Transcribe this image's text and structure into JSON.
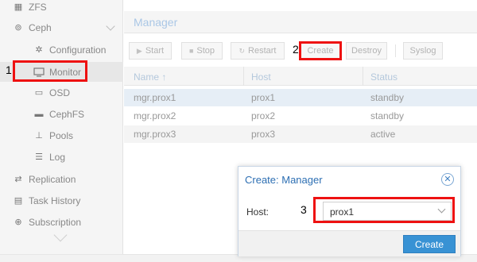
{
  "sidebar": {
    "items": [
      {
        "label": "ZFS",
        "icon": "zfs-icon"
      },
      {
        "label": "Ceph",
        "icon": "ceph-icon"
      },
      {
        "label": "Configuration",
        "icon": "gear-icon"
      },
      {
        "label": "Monitor",
        "icon": "monitor-icon"
      },
      {
        "label": "OSD",
        "icon": "hdd-icon"
      },
      {
        "label": "CephFS",
        "icon": "folder-icon"
      },
      {
        "label": "Pools",
        "icon": "sitemap-icon"
      },
      {
        "label": "Log",
        "icon": "list-icon"
      },
      {
        "label": "Replication",
        "icon": "retweet-icon"
      },
      {
        "label": "Task History",
        "icon": "list-alt-icon"
      },
      {
        "label": "Subscription",
        "icon": "support-icon"
      }
    ]
  },
  "panel": {
    "title": "Manager"
  },
  "toolbar": {
    "start": "Start",
    "stop": "Stop",
    "restart": "Restart",
    "create": "Create",
    "destroy": "Destroy",
    "syslog": "Syslog"
  },
  "grid": {
    "columns": [
      "Name ↑",
      "Host",
      "Status"
    ],
    "rows": [
      {
        "name": "mgr.prox1",
        "host": "prox1",
        "status": "standby"
      },
      {
        "name": "mgr.prox2",
        "host": "prox2",
        "status": "standby"
      },
      {
        "name": "mgr.prox3",
        "host": "prox3",
        "status": "active"
      }
    ]
  },
  "annotations": {
    "one": "1",
    "two": "2",
    "three": "3"
  },
  "dialog": {
    "title": "Create: Manager",
    "host_label": "Host:",
    "host_value": "prox1",
    "create": "Create"
  },
  "colors": {
    "accent": "#3892d4",
    "annotation": "#ee1111",
    "title": "#2d6fb3"
  }
}
